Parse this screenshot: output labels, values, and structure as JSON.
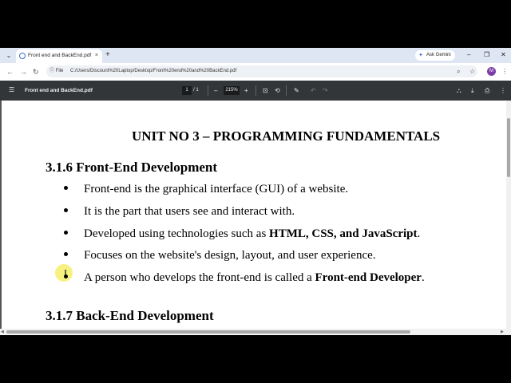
{
  "browser": {
    "tab": {
      "title": "Front end and BackEnd.pdf",
      "close": "×"
    },
    "new_tab": "+",
    "ask_gemini": "Ask Gemini",
    "window_controls": {
      "tab_search": "⌄",
      "minimize": "–",
      "restore": "❐",
      "close": "✕"
    },
    "nav": {
      "back": "←",
      "forward": "→",
      "reload": "↻"
    },
    "address": {
      "scheme_chip": "File",
      "url": "C:/Users/Discount%20Laptop/Desktop/Front%20end%20and%20BackEnd.pdf"
    },
    "profile_initial": "M"
  },
  "pdf_toolbar": {
    "title": "Front end and BackEnd.pdf",
    "page_current": "1",
    "page_total": "/  1",
    "zoom": "215%",
    "zoom_out": "–",
    "zoom_in": "+"
  },
  "document": {
    "unit_title": "UNIT NO 3 – PROGRAMMING FUNDAMENTALS",
    "section_1": {
      "heading": "3.1.6 Front-End Development",
      "bullets": [
        {
          "text": "Front-end is the graphical interface (GUI) of a website."
        },
        {
          "text": "It is the part that users see and interact with."
        },
        {
          "pre": "Developed using technologies such as ",
          "bold": "HTML, CSS, and JavaScript",
          "post": "."
        },
        {
          "text": "Focuses on the website's design, layout, and user experience."
        },
        {
          "pre": "A person who develops the front-end is called a ",
          "bold": "Front-end Developer",
          "post": "."
        }
      ]
    },
    "section_2": {
      "heading": "3.1.7 Back-End Development"
    }
  },
  "colors": {
    "tabstrip": "#dfe6f3",
    "pdf_toolbar": "#323639",
    "viewer_bg": "#525659",
    "cursor_highlight": "#f5ef6a",
    "profile": "#7b3ea8"
  },
  "icons": [
    "pdf-favicon-icon",
    "gemini-star-icon",
    "info-icon",
    "zoom-lens-icon",
    "star-icon",
    "hamburger-icon",
    "fit-page-icon",
    "rotate-icon",
    "annotate-icon",
    "undo-icon",
    "redo-icon",
    "download-icon",
    "print-icon",
    "more-icon"
  ]
}
